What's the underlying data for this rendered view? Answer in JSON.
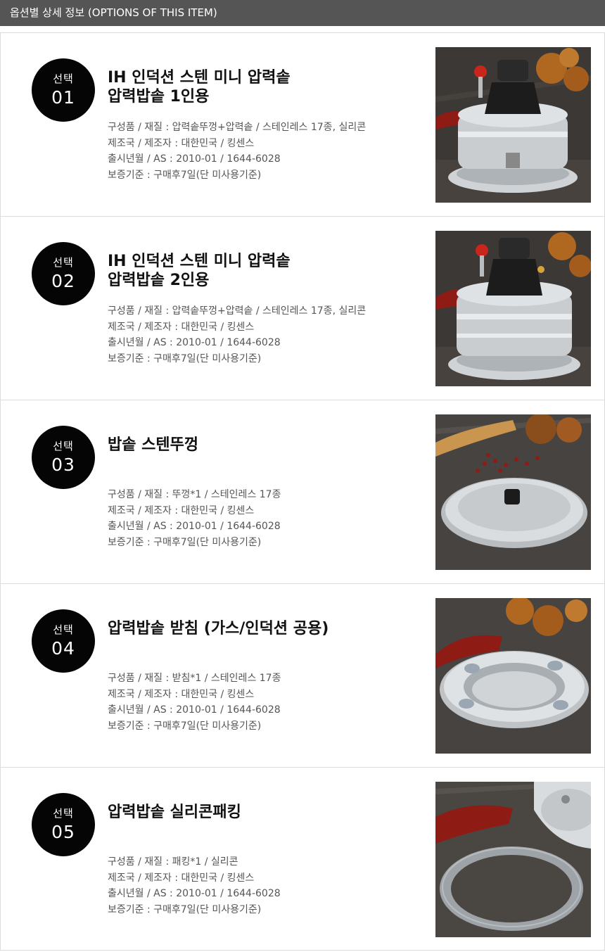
{
  "header": {
    "title": "옵션별 상세 정보 (OPTIONS OF THIS ITEM)"
  },
  "badge_label": "선택",
  "items": [
    {
      "number": "01",
      "title": "IH 인덕션 스텐 미니 압력솥\n압력밥솥 1인용",
      "composition": "구성품 / 재질 : 압력솥뚜껑+압력솥 / 스테인레스 17종, 실리콘",
      "maker": "제조국 / 제조자 : 대한민국 / 킹센스",
      "release": "출시년월 / AS : 2010-01 / 1644-6028",
      "warranty": "보증기준 : 구매후7일(단 미사용기준)",
      "image_icon": "pressure-cooker-1-serving"
    },
    {
      "number": "02",
      "title": "IH 인덕션 스텐 미니 압력솥\n압력밥솥 2인용",
      "composition": "구성품 / 재질 : 압력솥뚜껑+압력솥 / 스테인레스 17종, 실리콘",
      "maker": "제조국 / 제조자 : 대한민국 / 킹센스",
      "release": "출시년월 / AS : 2010-01 / 1644-6028",
      "warranty": "보증기준 : 구매후7일(단 미사용기준)",
      "image_icon": "pressure-cooker-2-serving"
    },
    {
      "number": "03",
      "title": "밥솥 스텐뚜껑",
      "composition": "구성품 / 재질 : 뚜껑*1 / 스테인레스 17종",
      "maker": "제조국 / 제조자 : 대한민국 / 킹센스",
      "release": "출시년월 / AS : 2010-01 / 1644-6028",
      "warranty": "보증기준 : 구매후7일(단 미사용기준)",
      "image_icon": "steel-lid"
    },
    {
      "number": "04",
      "title": "압력밥솥 받침 (가스/인덕션 공용)",
      "composition": "구성품 / 재질 : 받침*1 / 스테인레스 17종",
      "maker": "제조국 / 제조자 : 대한민국 / 킹센스",
      "release": "출시년월 / AS : 2010-01 / 1644-6028",
      "warranty": "보증기준 : 구매후7일(단 미사용기준)",
      "image_icon": "cooker-stand"
    },
    {
      "number": "05",
      "title": "압력밥솥 실리콘패킹",
      "composition": "구성품 / 재질 : 패킹*1 / 실리콘",
      "maker": "제조국 / 제조자 : 대한민국 / 킹센스",
      "release": "출시년월 / AS : 2010-01 / 1644-6028",
      "warranty": "보증기준 : 구매후7일(단 미사용기준)",
      "image_icon": "silicone-gasket"
    }
  ],
  "colors": {
    "header_bg": "#555555",
    "badge_bg": "#050505",
    "wood_dark": "#3e3b38",
    "spatula_red": "#8e1c14"
  }
}
